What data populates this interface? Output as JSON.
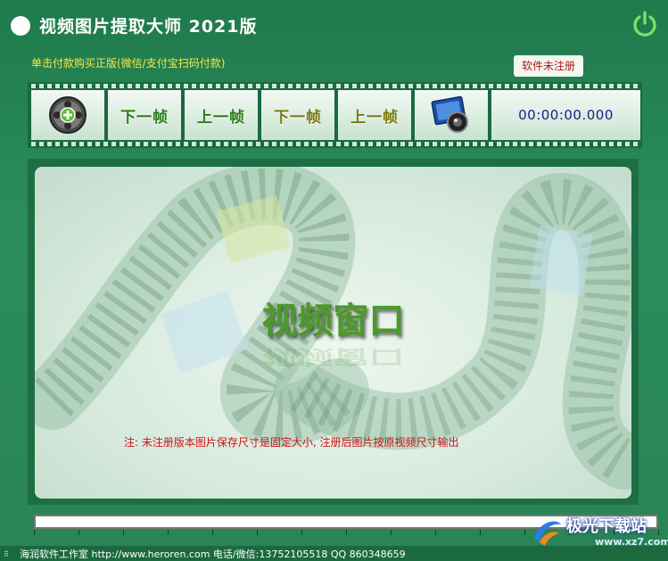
{
  "title_bar": {
    "app_title": "视频图片提取大师  2021版",
    "power_icon": "power-icon"
  },
  "purchase_link": "单击付款购买正版(微信/支付宝扫码付款)",
  "registration_status": "软件未注册",
  "toolbar": {
    "open_icon": "film-reel-add-icon",
    "next_frame_label": "下一帧",
    "prev_frame_label": "上一帧",
    "next_frame_alt_label": "下一帧",
    "prev_frame_alt_label": "上一帧",
    "snapshot_icon": "photo-capture-icon",
    "timecode": "00:00:00.000"
  },
  "video": {
    "title": "视频窗口",
    "note": "注: 未注册版本图片保存尺寸是固定大小, 注册后图片按原视频尺寸输出"
  },
  "progress": {
    "value": 0
  },
  "status_bar": {
    "text": "海润软件工作室 http://www.heroren.com  电话/微信:13752105518  QQ 860348659"
  },
  "watermark": {
    "brand": "极光下载站",
    "url": "www.xz7.com"
  },
  "colors": {
    "background": "#2b8d5b",
    "toolbar": "#1b6a3f",
    "accent_green": "#4c9a2a",
    "warning_red": "#d01414",
    "purchase_yellow": "#ffe64a",
    "timecode_blue": "#17208a"
  }
}
